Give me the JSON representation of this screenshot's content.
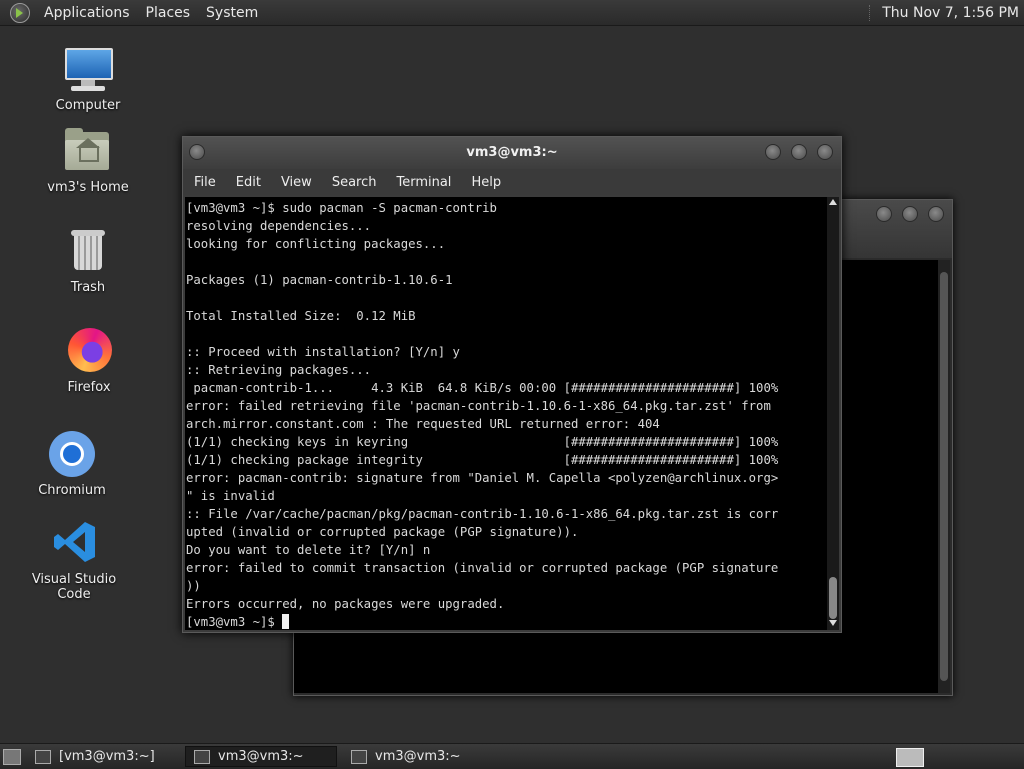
{
  "top_panel": {
    "menus": [
      "Applications",
      "Places",
      "System"
    ],
    "clock": "Thu Nov 7,  1:56 PM"
  },
  "desktop_icons": [
    {
      "label": "Computer",
      "icon": "computer-icon"
    },
    {
      "label": "vm3's Home",
      "icon": "home-folder-icon"
    },
    {
      "label": "Trash",
      "icon": "trash-icon"
    },
    {
      "label": "Firefox",
      "icon": "firefox-icon"
    },
    {
      "label": "Chromium",
      "icon": "chromium-icon"
    },
    {
      "label": "Visual Studio Code",
      "icon": "vscode-icon"
    }
  ],
  "terminal": {
    "title": "vm3@vm3:~",
    "menu": [
      "File",
      "Edit",
      "View",
      "Search",
      "Terminal",
      "Help"
    ],
    "lines": [
      "[vm3@vm3 ~]$ sudo pacman -S pacman-contrib",
      "resolving dependencies...",
      "looking for conflicting packages...",
      "",
      "Packages (1) pacman-contrib-1.10.6-1",
      "",
      "Total Installed Size:  0.12 MiB",
      "",
      ":: Proceed with installation? [Y/n] y",
      ":: Retrieving packages...",
      " pacman-contrib-1...     4.3 KiB  64.8 KiB/s 00:00 [######################] 100%",
      "error: failed retrieving file 'pacman-contrib-1.10.6-1-x86_64.pkg.tar.zst' from",
      "arch.mirror.constant.com : The requested URL returned error: 404",
      "(1/1) checking keys in keyring                     [######################] 100%",
      "(1/1) checking package integrity                   [######################] 100%",
      "error: pacman-contrib: signature from \"Daniel M. Capella <polyzen@archlinux.org>",
      "\" is invalid",
      ":: File /var/cache/pacman/pkg/pacman-contrib-1.10.6-1-x86_64.pkg.tar.zst is corr",
      "upted (invalid or corrupted package (PGP signature)).",
      "Do you want to delete it? [Y/n] n",
      "error: failed to commit transaction (invalid or corrupted package (PGP signature",
      "))",
      "Errors occurred, no packages were upgraded."
    ],
    "prompt": "[vm3@vm3 ~]$ "
  },
  "taskbar": {
    "tasks": [
      {
        "label": "[vm3@vm3:~]",
        "active": false
      },
      {
        "label": "vm3@vm3:~",
        "active": true
      },
      {
        "label": "vm3@vm3:~",
        "active": false
      }
    ]
  }
}
